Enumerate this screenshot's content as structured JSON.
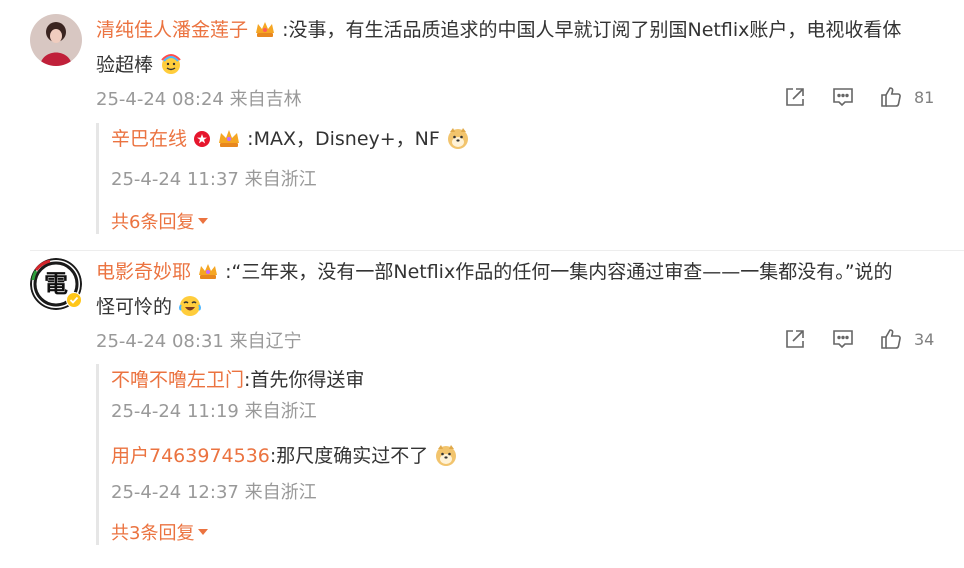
{
  "comments": [
    {
      "username": "清纯佳人潘金莲子",
      "separator": ":",
      "text": "没事，有生活品质追求的中国人早就订阅了别国Netflix账户，电视收看体",
      "text_line2": "验超棒",
      "meta": "25-4-24 08:24 来自吉林",
      "likes": "81",
      "replies": [
        {
          "username": "辛巴在线",
          "separator": ":",
          "text": "MAX，Disney+，NF",
          "meta": "25-4-24 11:37 来自浙江"
        }
      ],
      "more_replies": "共6条回复"
    },
    {
      "username": "电影奇妙耶",
      "separator": ":",
      "text": "“三年来，没有一部Netflix作品的任何一集内容通过审查——一集都没有。”说的",
      "text_line2": "怪可怜的",
      "meta": "25-4-24 08:31 来自辽宁",
      "likes": "34",
      "avatar_glyph": "電",
      "replies": [
        {
          "username": "不噜不噜左卫门",
          "separator": ":",
          "text": "首先你得送审",
          "meta": "25-4-24 11:19 来自浙江"
        },
        {
          "username": "用户7463974536",
          "separator": ":",
          "text": "那尺度确实过不了",
          "meta": "25-4-24 12:37 来自浙江"
        }
      ],
      "more_replies": "共3条回复"
    }
  ],
  "icons": {
    "share": "share-icon",
    "comment": "comment-icon",
    "like": "thumbs-up-icon"
  },
  "colors": {
    "username": "#eb7340",
    "meta": "#999999",
    "text": "#333333"
  }
}
